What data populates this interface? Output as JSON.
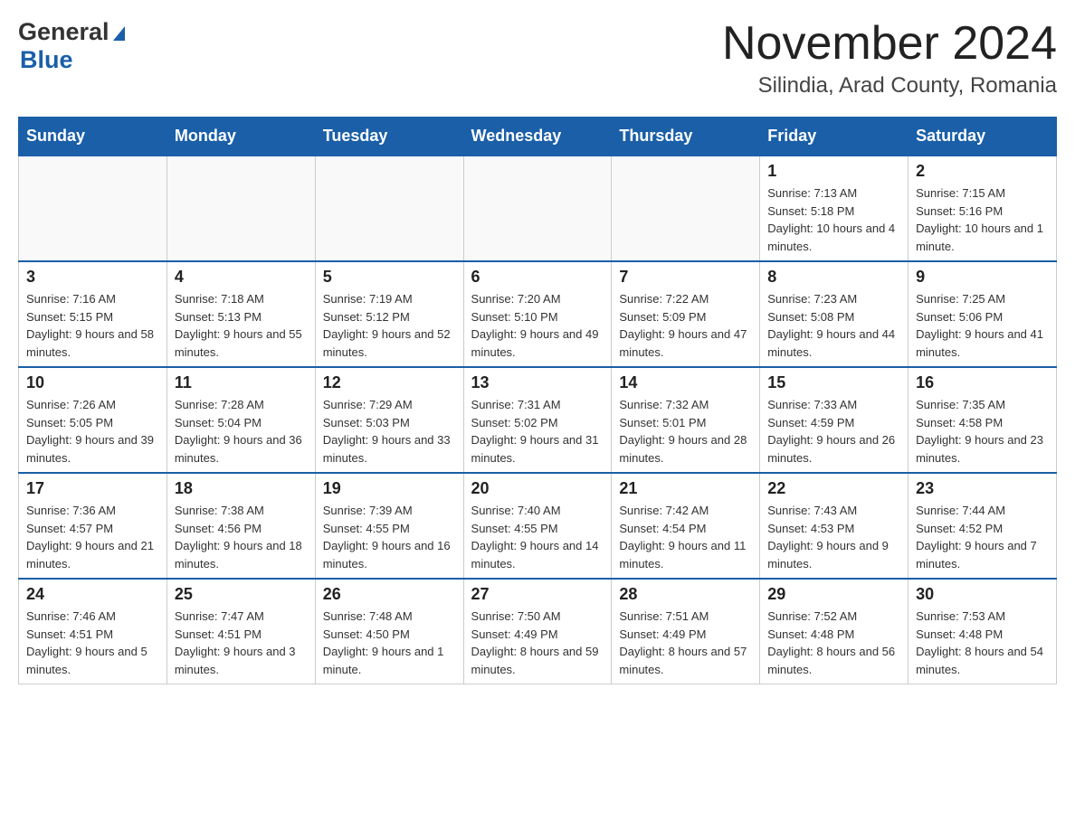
{
  "header": {
    "month_title": "November 2024",
    "location": "Silindia, Arad County, Romania",
    "logo_general": "General",
    "logo_blue": "Blue"
  },
  "days_of_week": [
    "Sunday",
    "Monday",
    "Tuesday",
    "Wednesday",
    "Thursday",
    "Friday",
    "Saturday"
  ],
  "weeks": [
    {
      "days": [
        {
          "num": "",
          "info": ""
        },
        {
          "num": "",
          "info": ""
        },
        {
          "num": "",
          "info": ""
        },
        {
          "num": "",
          "info": ""
        },
        {
          "num": "",
          "info": ""
        },
        {
          "num": "1",
          "info": "Sunrise: 7:13 AM\nSunset: 5:18 PM\nDaylight: 10 hours and 4 minutes."
        },
        {
          "num": "2",
          "info": "Sunrise: 7:15 AM\nSunset: 5:16 PM\nDaylight: 10 hours and 1 minute."
        }
      ]
    },
    {
      "days": [
        {
          "num": "3",
          "info": "Sunrise: 7:16 AM\nSunset: 5:15 PM\nDaylight: 9 hours and 58 minutes."
        },
        {
          "num": "4",
          "info": "Sunrise: 7:18 AM\nSunset: 5:13 PM\nDaylight: 9 hours and 55 minutes."
        },
        {
          "num": "5",
          "info": "Sunrise: 7:19 AM\nSunset: 5:12 PM\nDaylight: 9 hours and 52 minutes."
        },
        {
          "num": "6",
          "info": "Sunrise: 7:20 AM\nSunset: 5:10 PM\nDaylight: 9 hours and 49 minutes."
        },
        {
          "num": "7",
          "info": "Sunrise: 7:22 AM\nSunset: 5:09 PM\nDaylight: 9 hours and 47 minutes."
        },
        {
          "num": "8",
          "info": "Sunrise: 7:23 AM\nSunset: 5:08 PM\nDaylight: 9 hours and 44 minutes."
        },
        {
          "num": "9",
          "info": "Sunrise: 7:25 AM\nSunset: 5:06 PM\nDaylight: 9 hours and 41 minutes."
        }
      ]
    },
    {
      "days": [
        {
          "num": "10",
          "info": "Sunrise: 7:26 AM\nSunset: 5:05 PM\nDaylight: 9 hours and 39 minutes."
        },
        {
          "num": "11",
          "info": "Sunrise: 7:28 AM\nSunset: 5:04 PM\nDaylight: 9 hours and 36 minutes."
        },
        {
          "num": "12",
          "info": "Sunrise: 7:29 AM\nSunset: 5:03 PM\nDaylight: 9 hours and 33 minutes."
        },
        {
          "num": "13",
          "info": "Sunrise: 7:31 AM\nSunset: 5:02 PM\nDaylight: 9 hours and 31 minutes."
        },
        {
          "num": "14",
          "info": "Sunrise: 7:32 AM\nSunset: 5:01 PM\nDaylight: 9 hours and 28 minutes."
        },
        {
          "num": "15",
          "info": "Sunrise: 7:33 AM\nSunset: 4:59 PM\nDaylight: 9 hours and 26 minutes."
        },
        {
          "num": "16",
          "info": "Sunrise: 7:35 AM\nSunset: 4:58 PM\nDaylight: 9 hours and 23 minutes."
        }
      ]
    },
    {
      "days": [
        {
          "num": "17",
          "info": "Sunrise: 7:36 AM\nSunset: 4:57 PM\nDaylight: 9 hours and 21 minutes."
        },
        {
          "num": "18",
          "info": "Sunrise: 7:38 AM\nSunset: 4:56 PM\nDaylight: 9 hours and 18 minutes."
        },
        {
          "num": "19",
          "info": "Sunrise: 7:39 AM\nSunset: 4:55 PM\nDaylight: 9 hours and 16 minutes."
        },
        {
          "num": "20",
          "info": "Sunrise: 7:40 AM\nSunset: 4:55 PM\nDaylight: 9 hours and 14 minutes."
        },
        {
          "num": "21",
          "info": "Sunrise: 7:42 AM\nSunset: 4:54 PM\nDaylight: 9 hours and 11 minutes."
        },
        {
          "num": "22",
          "info": "Sunrise: 7:43 AM\nSunset: 4:53 PM\nDaylight: 9 hours and 9 minutes."
        },
        {
          "num": "23",
          "info": "Sunrise: 7:44 AM\nSunset: 4:52 PM\nDaylight: 9 hours and 7 minutes."
        }
      ]
    },
    {
      "days": [
        {
          "num": "24",
          "info": "Sunrise: 7:46 AM\nSunset: 4:51 PM\nDaylight: 9 hours and 5 minutes."
        },
        {
          "num": "25",
          "info": "Sunrise: 7:47 AM\nSunset: 4:51 PM\nDaylight: 9 hours and 3 minutes."
        },
        {
          "num": "26",
          "info": "Sunrise: 7:48 AM\nSunset: 4:50 PM\nDaylight: 9 hours and 1 minute."
        },
        {
          "num": "27",
          "info": "Sunrise: 7:50 AM\nSunset: 4:49 PM\nDaylight: 8 hours and 59 minutes."
        },
        {
          "num": "28",
          "info": "Sunrise: 7:51 AM\nSunset: 4:49 PM\nDaylight: 8 hours and 57 minutes."
        },
        {
          "num": "29",
          "info": "Sunrise: 7:52 AM\nSunset: 4:48 PM\nDaylight: 8 hours and 56 minutes."
        },
        {
          "num": "30",
          "info": "Sunrise: 7:53 AM\nSunset: 4:48 PM\nDaylight: 8 hours and 54 minutes."
        }
      ]
    }
  ]
}
